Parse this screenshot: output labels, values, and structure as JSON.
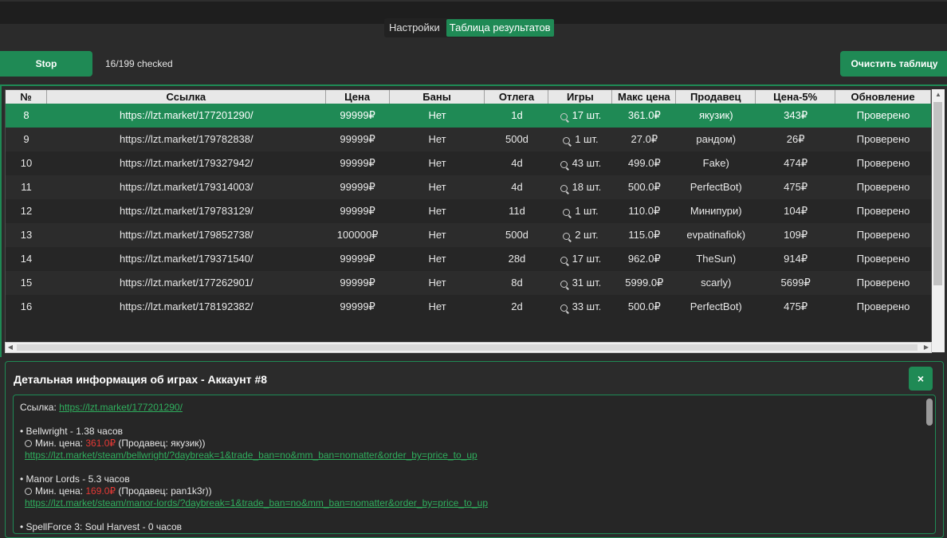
{
  "tabs": [
    {
      "label": "Настройки",
      "active": false
    },
    {
      "label": "Таблица результатов",
      "active": true
    }
  ],
  "toolbar": {
    "stop_label": "Stop",
    "checked_status": "16/199 checked",
    "clear_label": "Очистить таблицу"
  },
  "table": {
    "columns": [
      "№",
      "Ссылка",
      "Цена",
      "Баны",
      "Отлега",
      "Игры",
      "Макс цена",
      "Продавец",
      "Цена-5%",
      "Обновление"
    ],
    "selected_row": 0,
    "rows": [
      {
        "num": "8",
        "link": "https://lzt.market/177201290/",
        "price": "99999₽",
        "bans": "Нет",
        "otlega": "1d",
        "games": "17 шт.",
        "max_price": "361.0₽",
        "seller": "якузик)",
        "price5": "343₽",
        "update": "Проверено"
      },
      {
        "num": "9",
        "link": "https://lzt.market/179782838/",
        "price": "99999₽",
        "bans": "Нет",
        "otlega": "500d",
        "games": "1 шт.",
        "max_price": "27.0₽",
        "seller": "рандом)",
        "price5": "26₽",
        "update": "Проверено"
      },
      {
        "num": "10",
        "link": "https://lzt.market/179327942/",
        "price": "99999₽",
        "bans": "Нет",
        "otlega": "4d",
        "games": "43 шт.",
        "max_price": "499.0₽",
        "seller": "Fake)",
        "price5": "474₽",
        "update": "Проверено"
      },
      {
        "num": "11",
        "link": "https://lzt.market/179314003/",
        "price": "99999₽",
        "bans": "Нет",
        "otlega": "4d",
        "games": "18 шт.",
        "max_price": "500.0₽",
        "seller": "PerfectBot)",
        "price5": "475₽",
        "update": "Проверено"
      },
      {
        "num": "12",
        "link": "https://lzt.market/179783129/",
        "price": "99999₽",
        "bans": "Нет",
        "otlega": "11d",
        "games": "1 шт.",
        "max_price": "110.0₽",
        "seller": "Минипури)",
        "price5": "104₽",
        "update": "Проверено"
      },
      {
        "num": "13",
        "link": "https://lzt.market/179852738/",
        "price": "100000₽",
        "bans": "Нет",
        "otlega": "500d",
        "games": "2 шт.",
        "max_price": "115.0₽",
        "seller": "evpatinafiok)",
        "price5": "109₽",
        "update": "Проверено"
      },
      {
        "num": "14",
        "link": "https://lzt.market/179371540/",
        "price": "99999₽",
        "bans": "Нет",
        "otlega": "28d",
        "games": "17 шт.",
        "max_price": "962.0₽",
        "seller": "TheSun)",
        "price5": "914₽",
        "update": "Проверено"
      },
      {
        "num": "15",
        "link": "https://lzt.market/177262901/",
        "price": "99999₽",
        "bans": "Нет",
        "otlega": "8d",
        "games": "31 шт.",
        "max_price": "5999.0₽",
        "seller": "scarly)",
        "price5": "5699₽",
        "update": "Проверено"
      },
      {
        "num": "16",
        "link": "https://lzt.market/178192382/",
        "price": "99999₽",
        "bans": "Нет",
        "otlega": "2d",
        "games": "33 шт.",
        "max_price": "500.0₽",
        "seller": "PerfectBot)",
        "price5": "475₽",
        "update": "Проверено"
      }
    ]
  },
  "details": {
    "title": "Детальная информация об играх - Аккаунт #8",
    "close_label": "×",
    "link_label": "Ссылка: ",
    "link_url": "https://lzt.market/177201290/",
    "min_price_label": "Мин. цена: ",
    "games": [
      {
        "title": "• Bellwright - 1.38 часов",
        "min_price": "361.0₽",
        "seller_text": " (Продавец: якузик))",
        "url": "https://lzt.market/steam/bellwright/?daybreak=1&trade_ban=no&mm_ban=nomatter&order_by=price_to_up"
      },
      {
        "title": "• Manor Lords - 5.3 часов",
        "min_price": "169.0₽",
        "seller_text": " (Продавец: pan1k3r))",
        "url": "https://lzt.market/steam/manor-lords/?daybreak=1&trade_ban=no&mm_ban=nomatter&order_by=price_to_up"
      },
      {
        "title": "• SpellForce 3: Soul Harvest - 0 часов"
      }
    ]
  }
}
